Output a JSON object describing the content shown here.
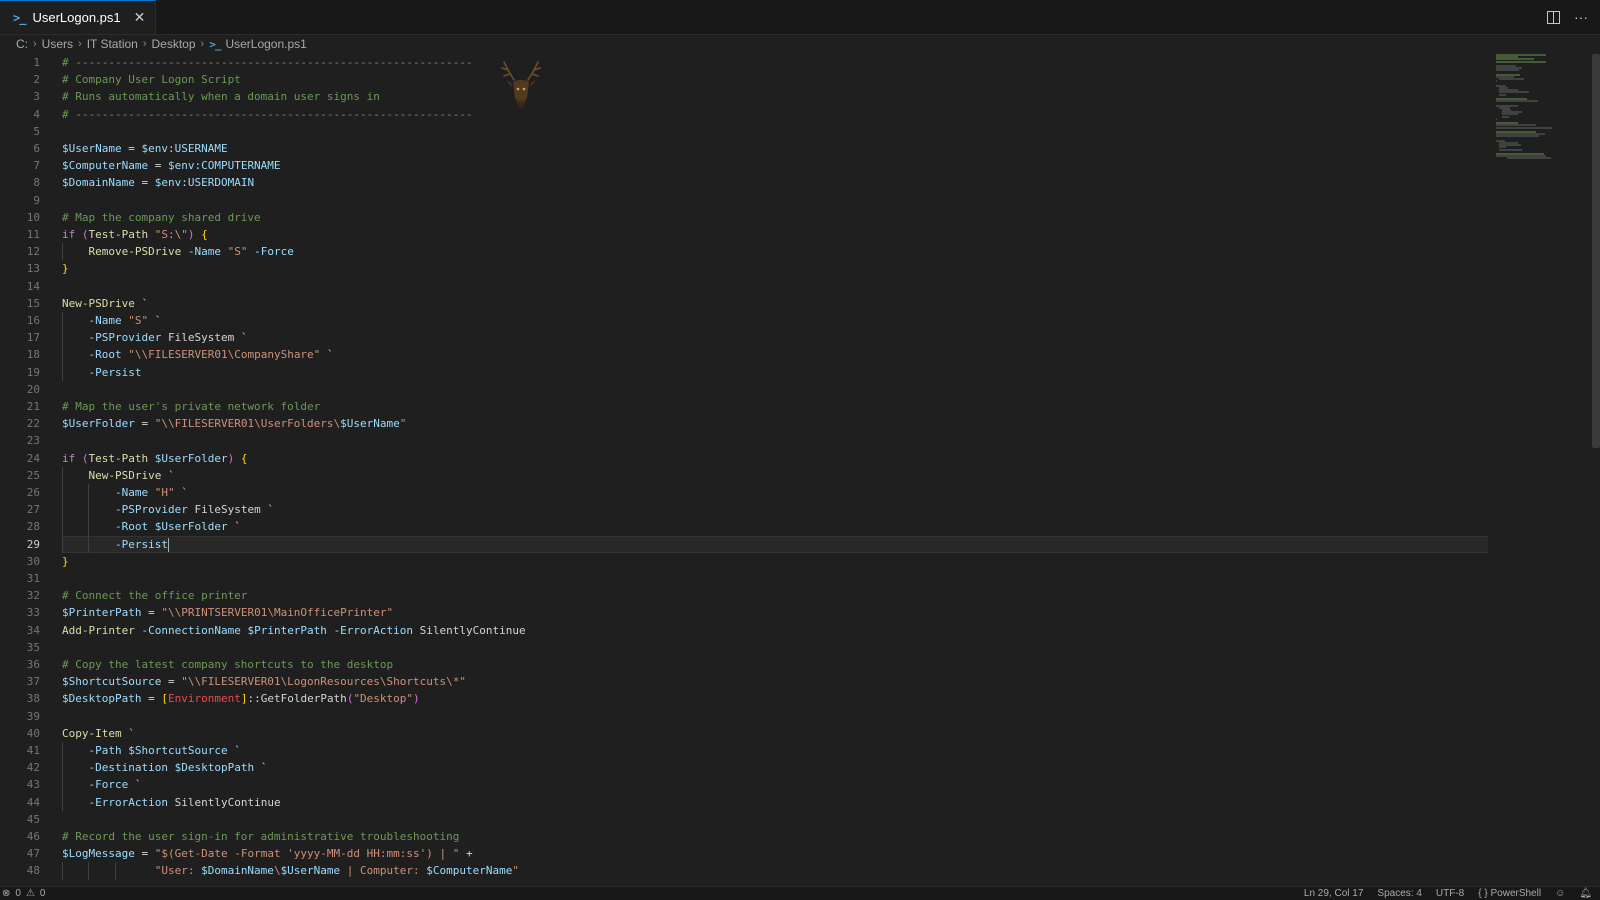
{
  "tab": {
    "filename": "UserLogon.ps1"
  },
  "breadcrumb": [
    "C:",
    "Users",
    "IT Station",
    "Desktop",
    "UserLogon.ps1"
  ],
  "cursor_line": 29,
  "lines": [
    "# ------------------------------------------------------------",
    "# Company User Logon Script",
    "# Runs automatically when a domain user signs in",
    "# ------------------------------------------------------------",
    "",
    "$UserName = $env:USERNAME",
    "$ComputerName = $env:COMPUTERNAME",
    "$DomainName = $env:USERDOMAIN",
    "",
    "# Map the company shared drive",
    "if (Test-Path \"S:\\\") {",
    "    Remove-PSDrive -Name \"S\" -Force",
    "}",
    "",
    "New-PSDrive `",
    "    -Name \"S\" `",
    "    -PSProvider FileSystem `",
    "    -Root \"\\\\FILESERVER01\\CompanyShare\" `",
    "    -Persist",
    "",
    "# Map the user's private network folder",
    "$UserFolder = \"\\\\FILESERVER01\\UserFolders\\$UserName\"",
    "",
    "if (Test-Path $UserFolder) {",
    "    New-PSDrive `",
    "        -Name \"H\" `",
    "        -PSProvider FileSystem `",
    "        -Root $UserFolder `",
    "        -Persist",
    "}",
    "",
    "# Connect the office printer",
    "$PrinterPath = \"\\\\PRINTSERVER01\\MainOfficePrinter\"",
    "Add-Printer -ConnectionName $PrinterPath -ErrorAction SilentlyContinue",
    "",
    "# Copy the latest company shortcuts to the desktop",
    "$ShortcutSource = \"\\\\FILESERVER01\\LogonResources\\Shortcuts\\*\"",
    "$DesktopPath = [Environment]::GetFolderPath(\"Desktop\")",
    "",
    "Copy-Item `",
    "    -Path $ShortcutSource `",
    "    -Destination $DesktopPath `",
    "    -Force `",
    "    -ErrorAction SilentlyContinue",
    "",
    "# Record the user sign-in for administrative troubleshooting",
    "$LogMessage = \"$(Get-Date -Format 'yyyy-MM-dd HH:mm:ss') | \" +",
    "              \"User: $DomainName\\$UserName | Computer: $ComputerName\""
  ],
  "status": {
    "errors": "0",
    "warnings": "0",
    "position": "Ln 29, Col 17",
    "spaces": "Spaces: 4",
    "encoding": "UTF-8",
    "language": "PowerShell"
  }
}
